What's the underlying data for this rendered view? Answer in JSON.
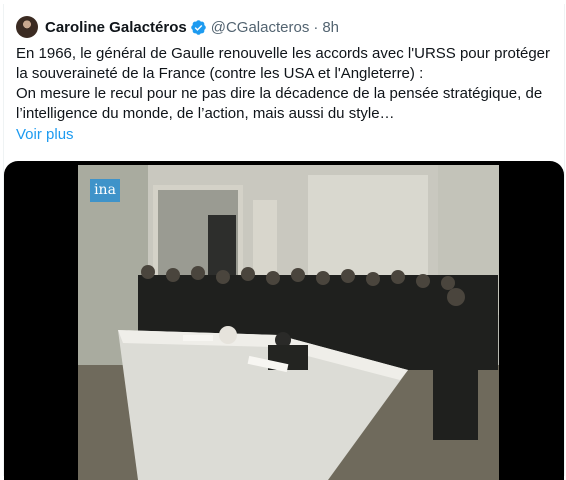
{
  "tweet": {
    "display_name": "Caroline Galactéros",
    "handle": "@CGalacteros",
    "separator": "·",
    "time": "8h",
    "lines": [
      "En 1966, le général de Gaulle renouvelle les accords avec l'URSS pour protéger",
      "la souveraineté de la France (contre les USA et l'Angleterre) :",
      "On mesure le recul pour ne pas dire la décadence de la pensée stratégique, de",
      "l’intelligence du monde, de l’action, mais aussi du style…"
    ],
    "show_more": "Voir plus"
  },
  "media": {
    "watermark": "ina",
    "watermark_color": "#3f93c9"
  },
  "colors": {
    "link": "#1d9bf0",
    "secondary_text": "#536471",
    "verified_badge": "#1d9bf0"
  }
}
